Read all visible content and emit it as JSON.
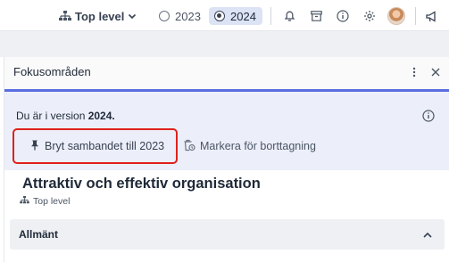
{
  "topbar": {
    "level_label": "Top level",
    "years": [
      {
        "label": "2023",
        "selected": false
      },
      {
        "label": "2024",
        "selected": true
      }
    ],
    "icons": [
      "hierarchy-icon",
      "chevron-down-icon",
      "bell-icon",
      "archive-icon",
      "info-icon",
      "gear-icon",
      "avatar",
      "megaphone-icon"
    ]
  },
  "panel": {
    "title": "Fokusområden",
    "version_prefix": "Du är i version ",
    "version_year": "2024.",
    "unlink_label": "Bryt sambandet till 2023",
    "mark_label": "Markera för borttagning",
    "org_title": "Attraktiv och effektiv organisation",
    "org_level": "Top level",
    "section_label": "Allmänt"
  },
  "colors": {
    "accent": "#5b6ee1",
    "highlight": "#e0201c",
    "version_bg": "#eceffa",
    "selected_year_bg": "#dbe3f4"
  }
}
